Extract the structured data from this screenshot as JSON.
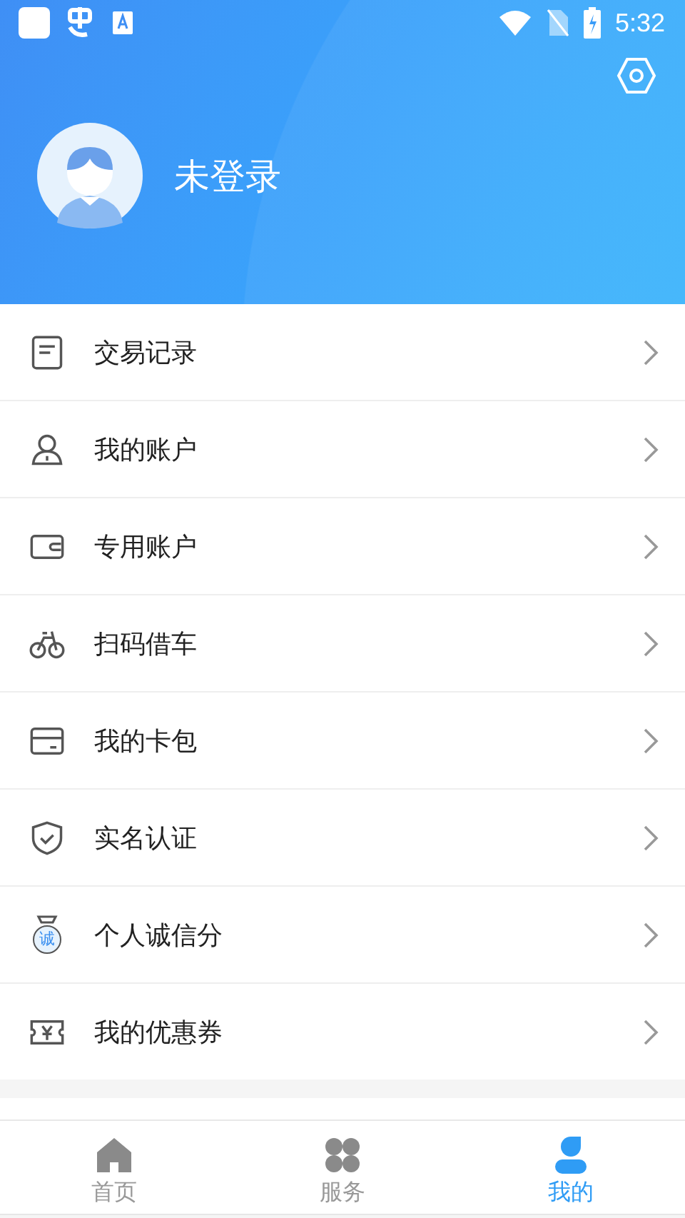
{
  "status_bar": {
    "time": "5:32"
  },
  "profile": {
    "name": "未登录"
  },
  "menu": [
    {
      "kind": "record",
      "label": "交易记录"
    },
    {
      "kind": "account",
      "label": "我的账户"
    },
    {
      "kind": "wallet",
      "label": "专用账户"
    },
    {
      "kind": "bike",
      "label": "扫码借车"
    },
    {
      "kind": "card",
      "label": "我的卡包"
    },
    {
      "kind": "shield",
      "label": "实名认证"
    },
    {
      "kind": "medal",
      "label": "个人诚信分",
      "badge": "诚"
    },
    {
      "kind": "coupon",
      "label": "我的优惠券"
    }
  ],
  "tabs": [
    {
      "kind": "home",
      "label": "首页",
      "selected": false
    },
    {
      "kind": "services",
      "label": "服务",
      "selected": false
    },
    {
      "kind": "me",
      "label": "我的",
      "selected": true
    }
  ]
}
